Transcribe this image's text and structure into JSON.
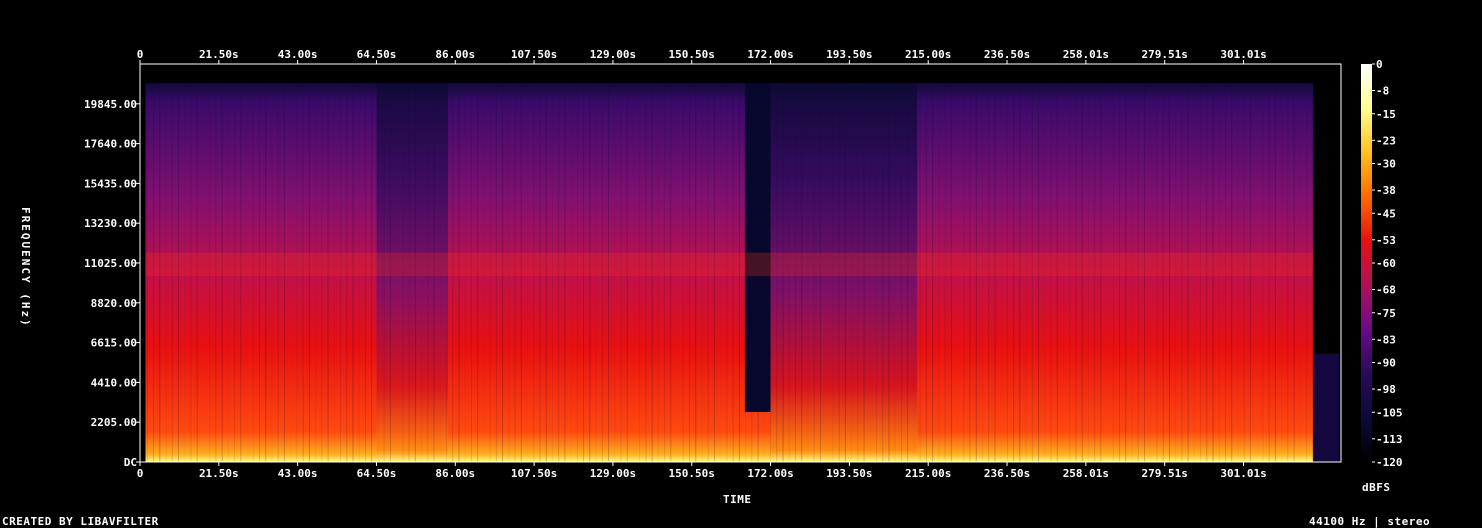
{
  "footer": {
    "credit": "CREATED BY LIBAVFILTER",
    "audio_info": "44100 Hz | stereo"
  },
  "colors": {
    "background": "#000000",
    "frame": "#ffffff",
    "colormap": [
      "#000000",
      "#0a0a3a",
      "#2a0a5a",
      "#6a0a8a",
      "#b0105a",
      "#e81010",
      "#ff6a00",
      "#ffc020",
      "#ffff90",
      "#ffffff"
    ]
  },
  "chart_data": {
    "type": "heatmap",
    "title": "",
    "xlabel": "TIME",
    "ylabel": "FREQUENCY (Hz)",
    "x_ticks": [
      "0",
      "21.50s",
      "43.00s",
      "64.50s",
      "86.00s",
      "107.50s",
      "129.00s",
      "150.50s",
      "172.00s",
      "193.50s",
      "215.00s",
      "236.50s",
      "258.01s",
      "279.51s",
      "301.01s"
    ],
    "x_tick_values": [
      0,
      21.5,
      43.0,
      64.5,
      86.0,
      107.5,
      129.0,
      150.5,
      172.0,
      193.5,
      215.0,
      236.5,
      258.01,
      279.51,
      301.01
    ],
    "xlim": [
      0,
      327.6
    ],
    "y_ticks": [
      "DC",
      "2205.00",
      "4410.00",
      "6615.00",
      "8820.00",
      "11025.00",
      "13230.00",
      "15435.00",
      "17640.00",
      "19845.00"
    ],
    "y_tick_values": [
      0,
      2205,
      4410,
      6615,
      8820,
      11025,
      13230,
      15435,
      17640,
      19845
    ],
    "ylim": [
      0,
      22050
    ],
    "colorbar": {
      "label": "dBFS",
      "ticks": [
        "0",
        "-8",
        "-15",
        "-23",
        "-30",
        "-38",
        "-45",
        "-53",
        "-60",
        "-68",
        "-75",
        "-83",
        "-90",
        "-98",
        "-105",
        "-113",
        "-120"
      ],
      "range": [
        -120,
        0
      ]
    }
  }
}
